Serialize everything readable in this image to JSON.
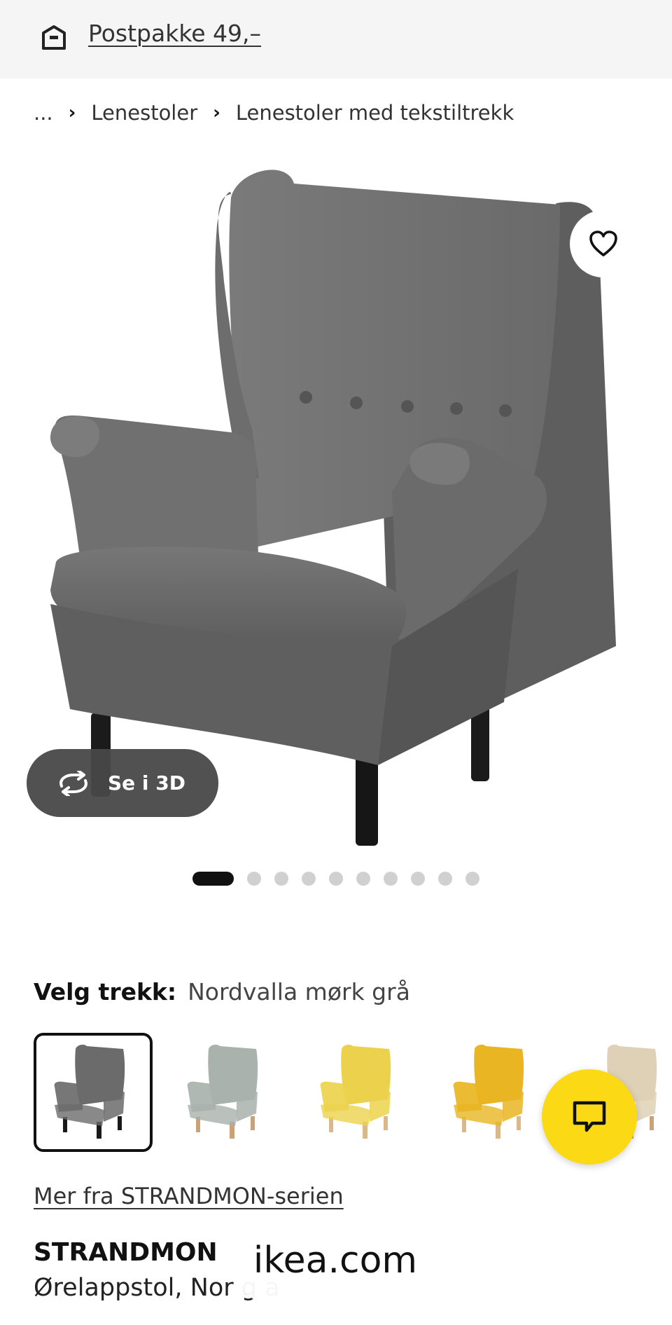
{
  "header": {
    "shipping_icon": "delivery-box-icon",
    "shipping_text": "Postpakke 49,–"
  },
  "breadcrumb": {
    "ellipsis": "...",
    "items": [
      "Lenestoler",
      "Lenestoler med tekstiltrekk"
    ]
  },
  "gallery": {
    "favorite_icon": "heart-outline-icon",
    "view_3d_label": "Se i 3D",
    "view_3d_icon": "rotate-icon",
    "image_count": 10,
    "active_index": 0
  },
  "cover": {
    "label": "Velg trekk:",
    "value": "Nordvalla mørk grå",
    "options": [
      {
        "color": "#6b6b6b",
        "legs": "#1a1a1a",
        "selected": true
      },
      {
        "color": "#a9b2ad",
        "legs": "#c9a27a",
        "selected": false
      },
      {
        "color": "#ecd24c",
        "legs": "#d9b889",
        "selected": false
      },
      {
        "color": "#e9b522",
        "legs": "#d9b889",
        "selected": false
      },
      {
        "color": "#dfd1b6",
        "legs": "#c9a27a",
        "selected": false
      }
    ]
  },
  "series_link": "Mer fra STRANDMON-serien",
  "product": {
    "name": "STRANDMON",
    "description": "Ørelappstol, Nor          g a"
  },
  "chat": {
    "icon": "chat-bubble-icon",
    "color": "#fbd914"
  },
  "watermark": "ikea.com"
}
